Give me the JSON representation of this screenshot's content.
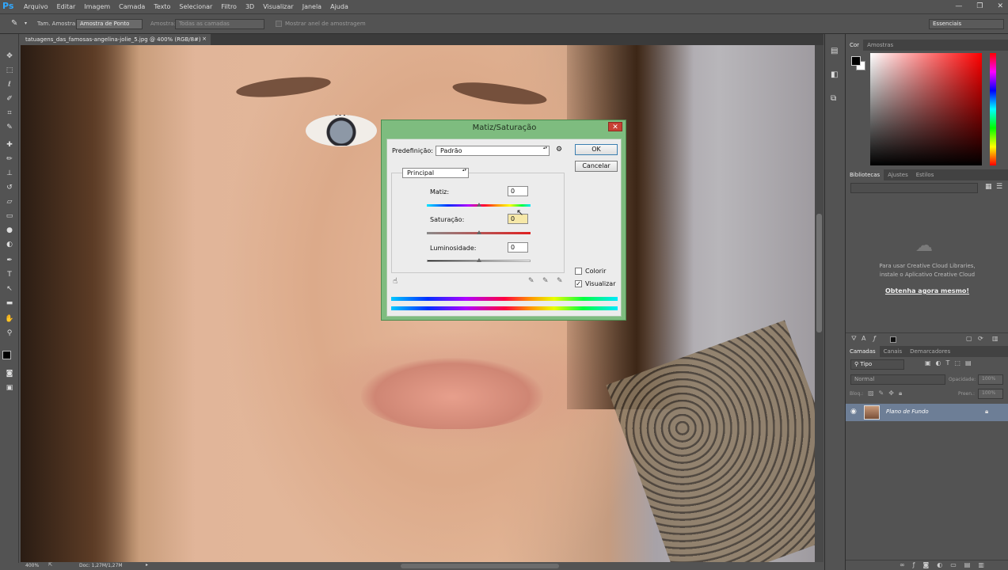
{
  "app": {
    "logo": "Ps"
  },
  "menu": [
    "Arquivo",
    "Editar",
    "Imagem",
    "Camada",
    "Texto",
    "Selecionar",
    "Filtro",
    "3D",
    "Visualizar",
    "Janela",
    "Ajuda"
  ],
  "options": {
    "size_label": "Tam. Amostra:",
    "size_value": "Amostra de Ponto",
    "sample_label": "Amostra:",
    "sample_value": "Todas as camadas",
    "ring_label": "Mostrar anel de amostragem",
    "workspace": "Essenciais"
  },
  "document": {
    "tab_title": "tatuagens_das_famosas-angelina-jolie_5.jpg @ 400% (RGB/8#)",
    "tab_close": "×"
  },
  "status": {
    "zoom": "400%",
    "doc": "Doc: 1,27M/1,27M"
  },
  "dialog": {
    "title": "Matiz/Saturação",
    "close": "✕",
    "preset_label": "Predefinição:",
    "preset_value": "Padrão",
    "ok": "OK",
    "cancel": "Cancelar",
    "channel": "Principal",
    "hue_label": "Matiz:",
    "hue_value": "0",
    "hue_level": 0.5,
    "saturation_label": "Saturação:",
    "saturation_value": "0",
    "saturation_level": 0.5,
    "lightness_label": "Luminosidade:",
    "lightness_value": "0",
    "lightness_level": 0.5,
    "colorize_label": "Colorir",
    "colorize_checked": false,
    "preview_label": "Visualizar",
    "preview_checked": true
  },
  "panels": {
    "color_tabs": [
      "Cor",
      "Amostras"
    ],
    "library_tabs": [
      "Bibliotecas",
      "Ajustes",
      "Estilos"
    ],
    "library_message_1": "Para usar Creative Cloud Libraries,",
    "library_message_2": "instale o Aplicativo Creative Cloud",
    "library_link": "Obtenha agora mesmo!",
    "layer_tabs": [
      "Camadas",
      "Canais",
      "Demarcadores"
    ],
    "filter_kind": "Tipo",
    "blend_mode": "Normal",
    "opacity_label": "Opacidade:",
    "opacity_value": "100%",
    "lock_label": "Bloq.:",
    "fill_label": "Preen.:",
    "fill_value": "100%",
    "layer_name": "Plano de Fundo"
  }
}
